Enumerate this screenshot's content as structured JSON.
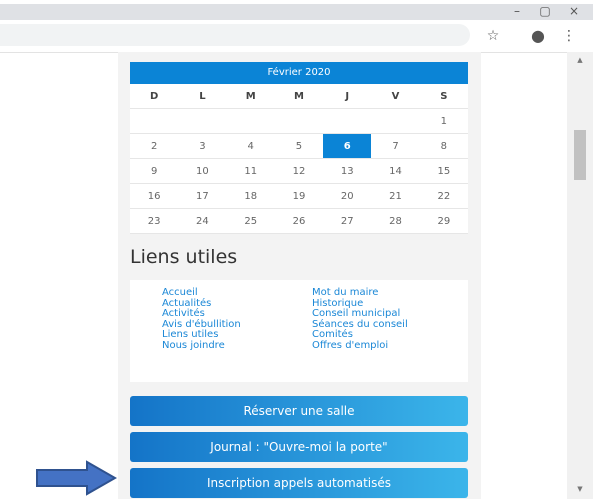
{
  "window": {
    "minimize": "–",
    "maximize": "▢",
    "close": "×"
  },
  "toolbar": {
    "star": "☆",
    "account": "●",
    "menu": "⋮"
  },
  "calendar": {
    "month": "Février 2020",
    "weekdays": [
      "D",
      "L",
      "M",
      "M",
      "J",
      "V",
      "S"
    ],
    "weeks": [
      [
        "",
        "",
        "",
        "",
        "",
        "",
        "1"
      ],
      [
        "2",
        "3",
        "4",
        "5",
        "6",
        "7",
        "8"
      ],
      [
        "9",
        "10",
        "11",
        "12",
        "13",
        "14",
        "15"
      ],
      [
        "16",
        "17",
        "18",
        "19",
        "20",
        "21",
        "22"
      ],
      [
        "23",
        "24",
        "25",
        "26",
        "27",
        "28",
        "29"
      ]
    ],
    "today": "6"
  },
  "liens": {
    "title": "Liens utiles",
    "left": [
      "Accueil",
      "Actualités",
      "Activités",
      "Avis d'ébullition",
      "Liens utiles",
      "Nous joindre"
    ],
    "right": [
      "Mot du maire",
      "Historique",
      "Conseil municipal",
      "Séances du conseil",
      "Comités",
      "Offres d'emploi"
    ]
  },
  "buttons": {
    "reserver": "Réserver une salle",
    "journal": "Journal : \"Ouvre-moi la porte\"",
    "inscription": "Inscription appels automatisés"
  },
  "colors": {
    "accent": "#0b84d6",
    "link": "#1a87d6",
    "arrow": "#4472c4"
  }
}
